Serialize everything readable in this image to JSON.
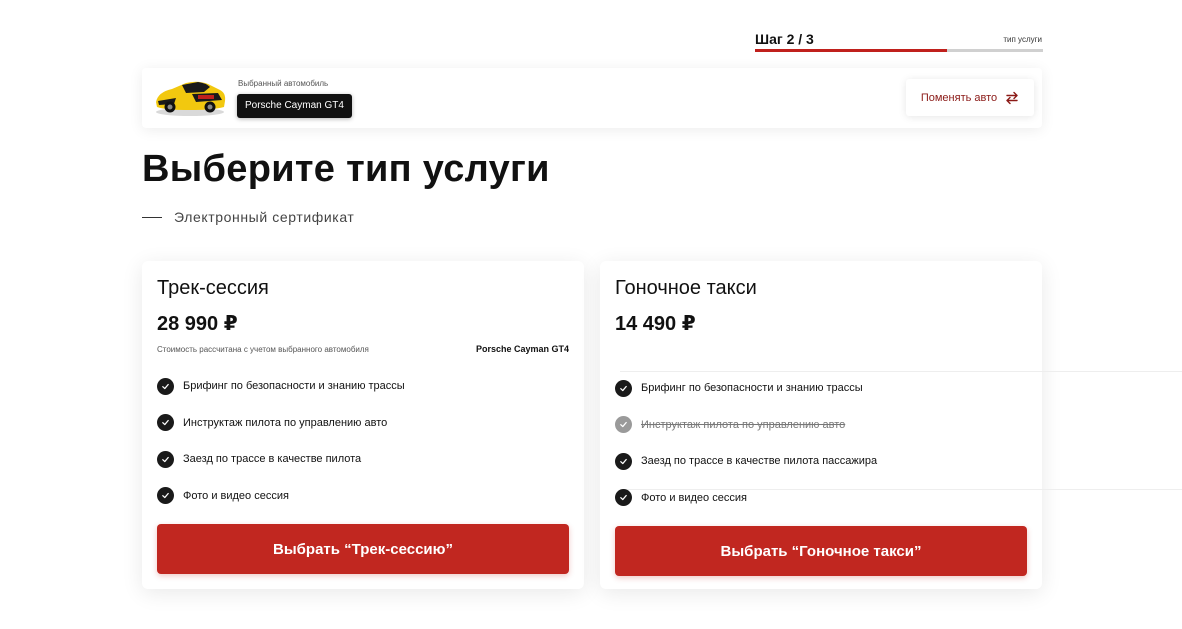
{
  "progress": {
    "step_label": "Шаг 2 / 3",
    "step_name": "тип услуги",
    "fraction": 0.667,
    "accent_color": "#c0201c"
  },
  "car": {
    "caption": "Выбранный автомобиль",
    "name": "Porsche Cayman GT4",
    "thumbnail_icon": "sports-car-icon",
    "change_label": "Поменять авто",
    "change_icon": "swap-arrows-icon"
  },
  "heading": {
    "title": "Выберите тип услуги",
    "subtitle": "Электронный сертификат"
  },
  "cards": [
    {
      "title": "Трек-сессия",
      "price": "28 990 ₽",
      "note": "Стоимость рассчитана с учетом выбранного автомобиля",
      "note_car": "Porsche Cayman GT4",
      "features": [
        {
          "text": "Брифинг по безопасности и знанию трассы",
          "included": true
        },
        {
          "text": "Инструктаж пилота по управлению авто",
          "included": true
        },
        {
          "text": "Заезд по трассе в качестве пилота",
          "included": true
        },
        {
          "text": "Фото и видео сессия",
          "included": true
        }
      ],
      "button_label": "Выбрать “Трек-сессию”"
    },
    {
      "title": "Гоночное такси",
      "price": "14 490 ₽",
      "features": [
        {
          "text": "Брифинг по безопасности и знанию трассы",
          "included": true
        },
        {
          "text": "Инструктаж пилота по управлению авто",
          "included": false
        },
        {
          "text": "Заезд по трассе в качестве пилота пассажира",
          "included": true
        },
        {
          "text": "Фото и видео сессия",
          "included": true
        }
      ],
      "button_label": "Выбрать “Гоночное такси”"
    }
  ],
  "colors": {
    "button": "#c12720",
    "check": "#1a1a1a",
    "check_disabled": "#9a9a9a"
  }
}
